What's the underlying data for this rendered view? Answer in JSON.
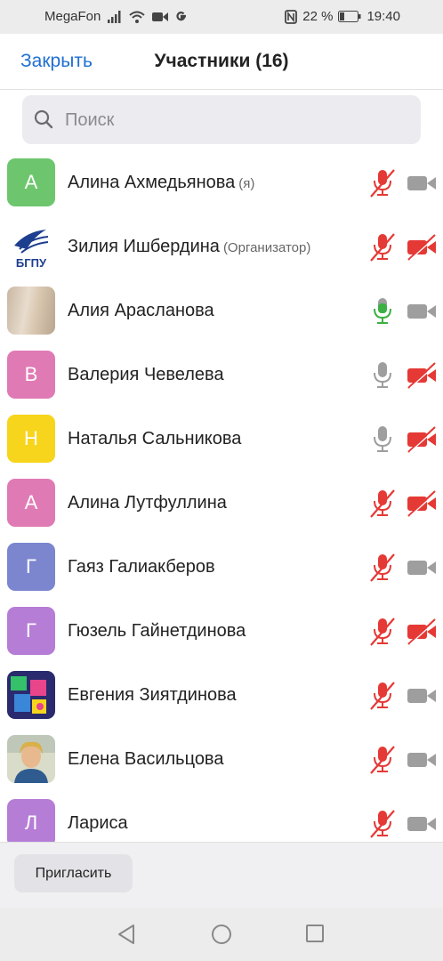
{
  "status_bar": {
    "carrier": "MegaFon",
    "battery": "22 %",
    "time": "19:40"
  },
  "header": {
    "close_label": "Закрыть",
    "title": "Участники (16)"
  },
  "search": {
    "placeholder": "Поиск"
  },
  "colors": {
    "accent": "#1f6fd1",
    "muted_red": "#e53935",
    "mic_green": "#3cb043",
    "icon_gray": "#9e9e9e"
  },
  "participants": [
    {
      "initial": "А",
      "name": "Алина Ахмедьянова",
      "role": "(я)",
      "avatar_color": "#6dc66d",
      "mic": "muted",
      "video": "off-gray"
    },
    {
      "initial": "",
      "name": "Зилия Ишбердина",
      "role": "(Организатор)",
      "avatar_type": "logo-bspu",
      "mic": "muted",
      "video": "off-red"
    },
    {
      "initial": "",
      "name": "Алия Арасланова",
      "role": "",
      "avatar_type": "photo-beige",
      "mic": "active",
      "video": "off-gray"
    },
    {
      "initial": "В",
      "name": "Валерия Чевелева",
      "role": "",
      "avatar_color": "#e07ab4",
      "mic": "on",
      "video": "off-red"
    },
    {
      "initial": "Н",
      "name": "Наталья Сальникова",
      "role": "",
      "avatar_color": "#f7d51d",
      "mic": "on",
      "video": "off-red"
    },
    {
      "initial": "А",
      "name": "Алина Лутфуллина",
      "role": "",
      "avatar_color": "#e07ab4",
      "mic": "muted",
      "video": "off-red"
    },
    {
      "initial": "Г",
      "name": "Гаяз Галиакберов",
      "role": "",
      "avatar_color": "#7b86cf",
      "mic": "muted",
      "video": "off-gray"
    },
    {
      "initial": "Г",
      "name": "Гюзель Гайнетдинова",
      "role": "",
      "avatar_color": "#b57dd6",
      "mic": "muted",
      "video": "off-red"
    },
    {
      "initial": "",
      "name": "Евгения Зиятдинова",
      "role": "",
      "avatar_type": "photo-collage",
      "mic": "muted",
      "video": "off-gray"
    },
    {
      "initial": "",
      "name": "Елена Васильцова",
      "role": "",
      "avatar_type": "photo-portrait",
      "mic": "muted",
      "video": "off-gray"
    },
    {
      "initial": "Л",
      "name": "Лариса",
      "role": "",
      "avatar_color": "#b57dd6",
      "mic": "muted",
      "video": "off-gray"
    }
  ],
  "footer": {
    "invite_label": "Пригласить"
  }
}
